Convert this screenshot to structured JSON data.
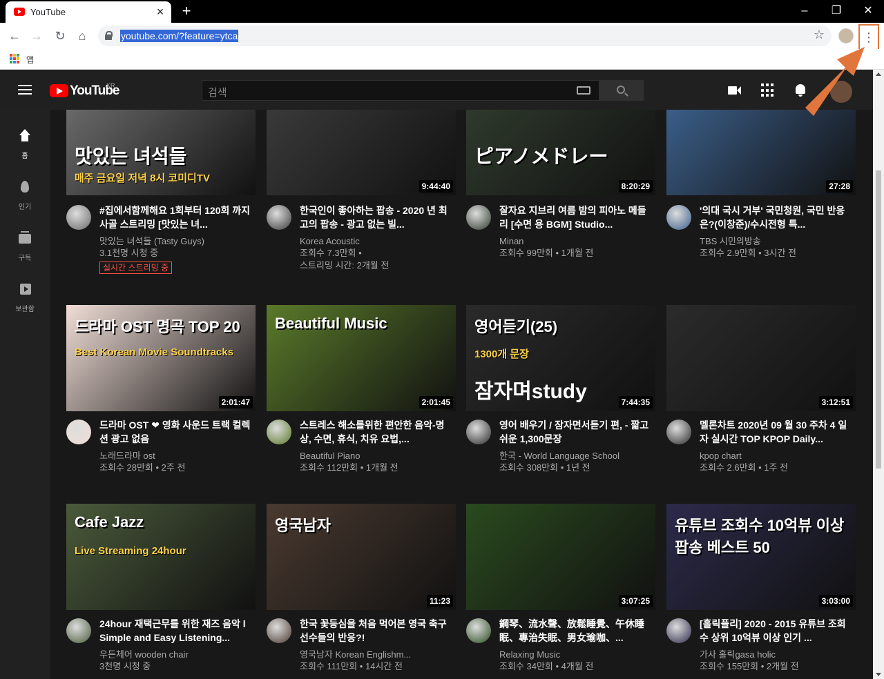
{
  "browser": {
    "tab_title": "YouTube",
    "url": "youtube.com/?feature=ytca",
    "bookmarks_apps_label": "앱"
  },
  "header": {
    "logo_text": "YouTube",
    "logo_region": "KR",
    "search_placeholder": "검색"
  },
  "sidenav": {
    "items": [
      {
        "label": "홈",
        "icon": "home-icon"
      },
      {
        "label": "인기",
        "icon": "trending-icon"
      },
      {
        "label": "구독",
        "icon": "subscriptions-icon"
      },
      {
        "label": "보관함",
        "icon": "library-icon"
      }
    ]
  },
  "videos": [
    {
      "title": "#집에서함께해요 1회부터 120회 까지 사골 스트리밍 [맛있는 녀...",
      "channel": "맛있는 녀석들 (Tasty Guys)",
      "stats": "3.1천명 시청 중",
      "live_badge": "실시간 스트리밍 중",
      "duration": "",
      "thumb_color": "#6a6a6a",
      "thumb_text": "맛있는 녀석들",
      "thumb_sub": "매주 금요일 저녁 8시 코미디TV"
    },
    {
      "title": "한국인이 좋아하는 팝송 - 2020 년 최고의 팝송 - 광고 없는 빌...",
      "channel": "Korea Acoustic",
      "stats": "조회수 7.3만회 •",
      "stats2": "스트리밍 시간: 2개월 전",
      "duration": "9:44:40",
      "thumb_color": "#3a3a3a"
    },
    {
      "title": "잘자요 지브리 여름 밤의 피아노 메들리 [수면 용 BGM] Studio...",
      "channel": "Minan",
      "stats": "조회수 99만회 • 1개월 전",
      "duration": "8:20:29",
      "thumb_color": "#2f3a2d",
      "thumb_text": "ピアノメドレー"
    },
    {
      "title": "'의대 국시 거부' 국민청원, 국민 반응은?(이창준)/수시전형 특...",
      "channel": "TBS 시민의방송",
      "stats": "조회수 2.9만회 • 3시간 전",
      "duration": "27:28",
      "thumb_color": "#3b5f8a"
    },
    {
      "title": "드라마 OST ❤ 영화 사운드 트랙 컬렉션 광고 없음",
      "channel": "노래드라마 ost",
      "stats": "조회수 28만회 • 2주 전",
      "duration": "2:01:47",
      "thumb_color": "#f0ddd6",
      "thumb_text": "드라마 OST 명곡 TOP 20",
      "thumb_sub": "Best Korean Movie Soundtracks"
    },
    {
      "title": "스트레스 해소를위한 편안한 음악-명상, 수면, 휴식, 치유 요법,...",
      "channel": "Beautiful Piano",
      "stats": "조회수 112만회 • 1개월 전",
      "duration": "2:01:45",
      "thumb_color": "#5a7a2a",
      "thumb_text": "Beautiful Music"
    },
    {
      "title": "영어 배우기 / 잠자면서듣기 편, - 짧고 쉬운 1,300문장",
      "channel": "한국 - World Language School",
      "stats": "조회수 308만회 • 1년 전",
      "duration": "7:44:35",
      "thumb_color": "#2a2a2a",
      "thumb_text": "영어듣기(25)",
      "thumb_sub": "1300개 문장",
      "thumb_sub2": "잠자며study"
    },
    {
      "title": "멜론차트 2020년 09 월 30 주차 4 일자 실시간 TOP KPOP Daily...",
      "channel": "kpop chart",
      "stats": "조회수 2.6만회 • 1주 전",
      "duration": "3:12:51",
      "thumb_color": "#2b2b2b"
    },
    {
      "title": "24hour 재택근무를 위한 재즈 음악 l Simple and Easy Listening...",
      "channel": "우든체어 wooden chair",
      "stats": "3천명 시청 중",
      "duration": "",
      "thumb_color": "#4a5a3a",
      "thumb_text": "Cafe Jazz",
      "thumb_sub": "Live Streaming 24hour"
    },
    {
      "title": "한국 꽃등심을 처음 먹어본 영국 축구선수들의 반응?!",
      "channel": "영국남자 Korean Englishm...",
      "stats": "조회수 111만회 • 14시간 전",
      "duration": "11:23",
      "thumb_color": "#4a3a30",
      "thumb_text": "영국남자"
    },
    {
      "title": "鋼琴、流水聲、放鬆睡覺、午休睡眠、專治失眠、男女瑜咖、...",
      "channel": "Relaxing Music",
      "stats": "조회수 34만회 • 4개월 전",
      "duration": "3:07:25",
      "thumb_color": "#2a4a1e"
    },
    {
      "title": "[홀릭플리] 2020 - 2015 유튜브 조회수 상위 10억뷰 이상 인기 ...",
      "channel": "가사 홀릭gasa holic",
      "stats": "조회수 155만회 • 2개월 전",
      "duration": "3:03:00",
      "thumb_color": "#2c2a4a",
      "thumb_text": "유튜브 조회수 10억뷰 이상 팝송 베스트 50"
    }
  ],
  "colors": {
    "accent": "#ff0000",
    "annotation": "#e0763b",
    "live": "#ff4e45"
  }
}
